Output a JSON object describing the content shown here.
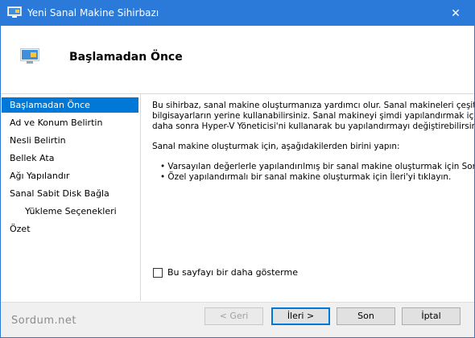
{
  "window": {
    "title": "Yeni Sanal Makine Sihirbazı",
    "close_glyph": "✕",
    "app_icon": "wizard-icon"
  },
  "header": {
    "title": "Başlamadan Önce",
    "icon": "wizard-icon"
  },
  "sidebar": {
    "items": [
      {
        "label": "Başlamadan Önce",
        "active": true
      },
      {
        "label": "Ad ve Konum Belirtin",
        "active": false
      },
      {
        "label": "Nesli Belirtin",
        "active": false
      },
      {
        "label": "Bellek Ata",
        "active": false
      },
      {
        "label": "Ağı Yapılandır",
        "active": false
      },
      {
        "label": "Sanal Sabit Disk Bağla",
        "active": false
      },
      {
        "label": "Yükleme Seçenekleri",
        "active": false,
        "sub": true
      },
      {
        "label": "Özet",
        "active": false
      }
    ]
  },
  "content": {
    "intro_lines": [
      "Bu sihirbaz, sanal makine oluşturmanıza yardımcı olur. Sanal makineleri çeşitli amaçla",
      "bilgisayarların yerine kullanabilirsiniz. Sanal makineyi şimdi yapılandırmak için bu sihirb",
      "daha sonra Hyper-V Yöneticisi'ni kullanarak bu yapılandırmayı değiştirebilirsiniz."
    ],
    "instruction": "Sanal makine oluşturmak için, aşağıdakilerden birini yapın:",
    "bullets": [
      "• Varsayılan değerlerle yapılandırılmış bir sanal makine oluşturmak için Son'u tıklayın",
      "• Özel yapılandırmalı bir sanal makine oluşturmak için İleri'yi tıklayın."
    ],
    "checkbox_label": "Bu sayfayı bir daha gösterme",
    "checkbox_checked": false
  },
  "footer": {
    "watermark": "Sordum.net",
    "prev_label": "< Geri",
    "next_label": "İleri >",
    "finish_label": "Son",
    "cancel_label": "İptal"
  },
  "colors": {
    "titlebar": "#2b79d8",
    "selection": "#0078d7"
  }
}
